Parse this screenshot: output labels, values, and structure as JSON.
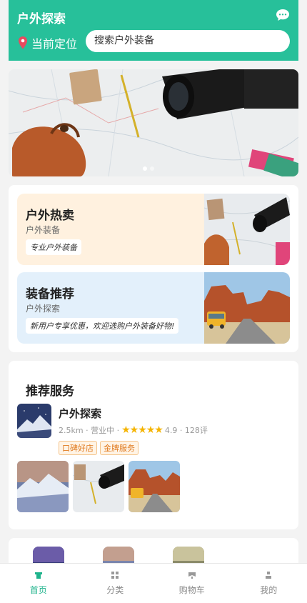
{
  "header": {
    "title": "户外探索",
    "location_label": "当前定位",
    "search_placeholder": "搜索户外装备",
    "icons": [
      "chat-icon",
      "location-pin-icon"
    ]
  },
  "banner": {
    "dots": 2,
    "active_dot": 0
  },
  "promos": [
    {
      "title": "户外热卖",
      "subtitle": "户外装备",
      "tag": "专业户外装备",
      "bg": "#fff1df"
    },
    {
      "title": "装备推荐",
      "subtitle": "户外探索",
      "tag": "新用户专享优惠，欢迎选购户外装备好物!",
      "bg": "#e3f0fb"
    }
  ],
  "services": {
    "section_title": "推荐服务",
    "name": "户外探索",
    "distance": "2.5km",
    "status": "营业中",
    "rating_stars": 5,
    "rating": "4.9",
    "reviews": "128评",
    "badges": [
      "口碑好店",
      "金牌服务"
    ]
  },
  "tabs": [
    {
      "label": "首页",
      "icon": "home-icon",
      "active": true
    },
    {
      "label": "分类",
      "icon": "grid-icon",
      "active": false
    },
    {
      "label": "购物车",
      "icon": "cart-icon",
      "active": false
    },
    {
      "label": "我的",
      "icon": "user-icon",
      "active": false
    }
  ],
  "colors": {
    "brand": "#27c09a",
    "active_tab": "#1fb38c",
    "star": "#f5b400",
    "badge_text": "#e07a1f"
  }
}
